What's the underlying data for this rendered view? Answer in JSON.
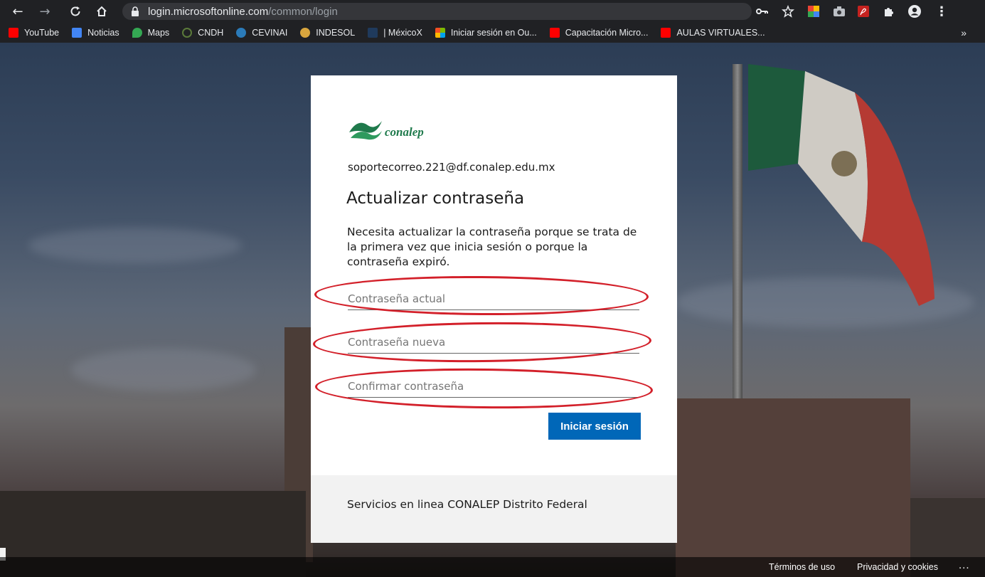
{
  "browser": {
    "url_host": "login.microsoftonline.com",
    "url_path": "/common/login",
    "bookmarks": [
      {
        "label": "YouTube",
        "color": "#ff0000"
      },
      {
        "label": "Noticias",
        "color": "#4285f4"
      },
      {
        "label": "Maps",
        "color": "#34a853"
      },
      {
        "label": "CNDH",
        "color": "#5b7a3a"
      },
      {
        "label": "CEVINAI",
        "color": "#2b7bb9"
      },
      {
        "label": "INDESOL",
        "color": "#d9a63e"
      },
      {
        "label": "| MéxicoX",
        "color": "#1f3a5c"
      },
      {
        "label": "Iniciar sesión en Ou...",
        "color": "#f25022"
      },
      {
        "label": "Capacitación Micro...",
        "color": "#ff0000"
      },
      {
        "label": "AULAS VIRTUALES...",
        "color": "#ff0000"
      }
    ],
    "bookmarks_overflow": "»"
  },
  "login": {
    "brand": "conalep",
    "brand_color": "#1f7a4c",
    "identity": "soportecorreo.221@df.conalep.edu.mx",
    "title": "Actualizar contraseña",
    "description": "Necesita actualizar la contraseña porque se trata de la primera vez que inicia sesión o porque la contraseña expiró.",
    "fields": {
      "current_placeholder": "Contraseña actual",
      "new_placeholder": "Contraseña nueva",
      "confirm_placeholder": "Confirmar contraseña"
    },
    "submit_label": "Iniciar sesión",
    "submit_color": "#0067b8",
    "footer_text": "Servicios en linea CONALEP Distrito Federal"
  },
  "page_footer": {
    "terms": "Términos de uso",
    "privacy": "Privacidad y cookies",
    "more": "..."
  }
}
